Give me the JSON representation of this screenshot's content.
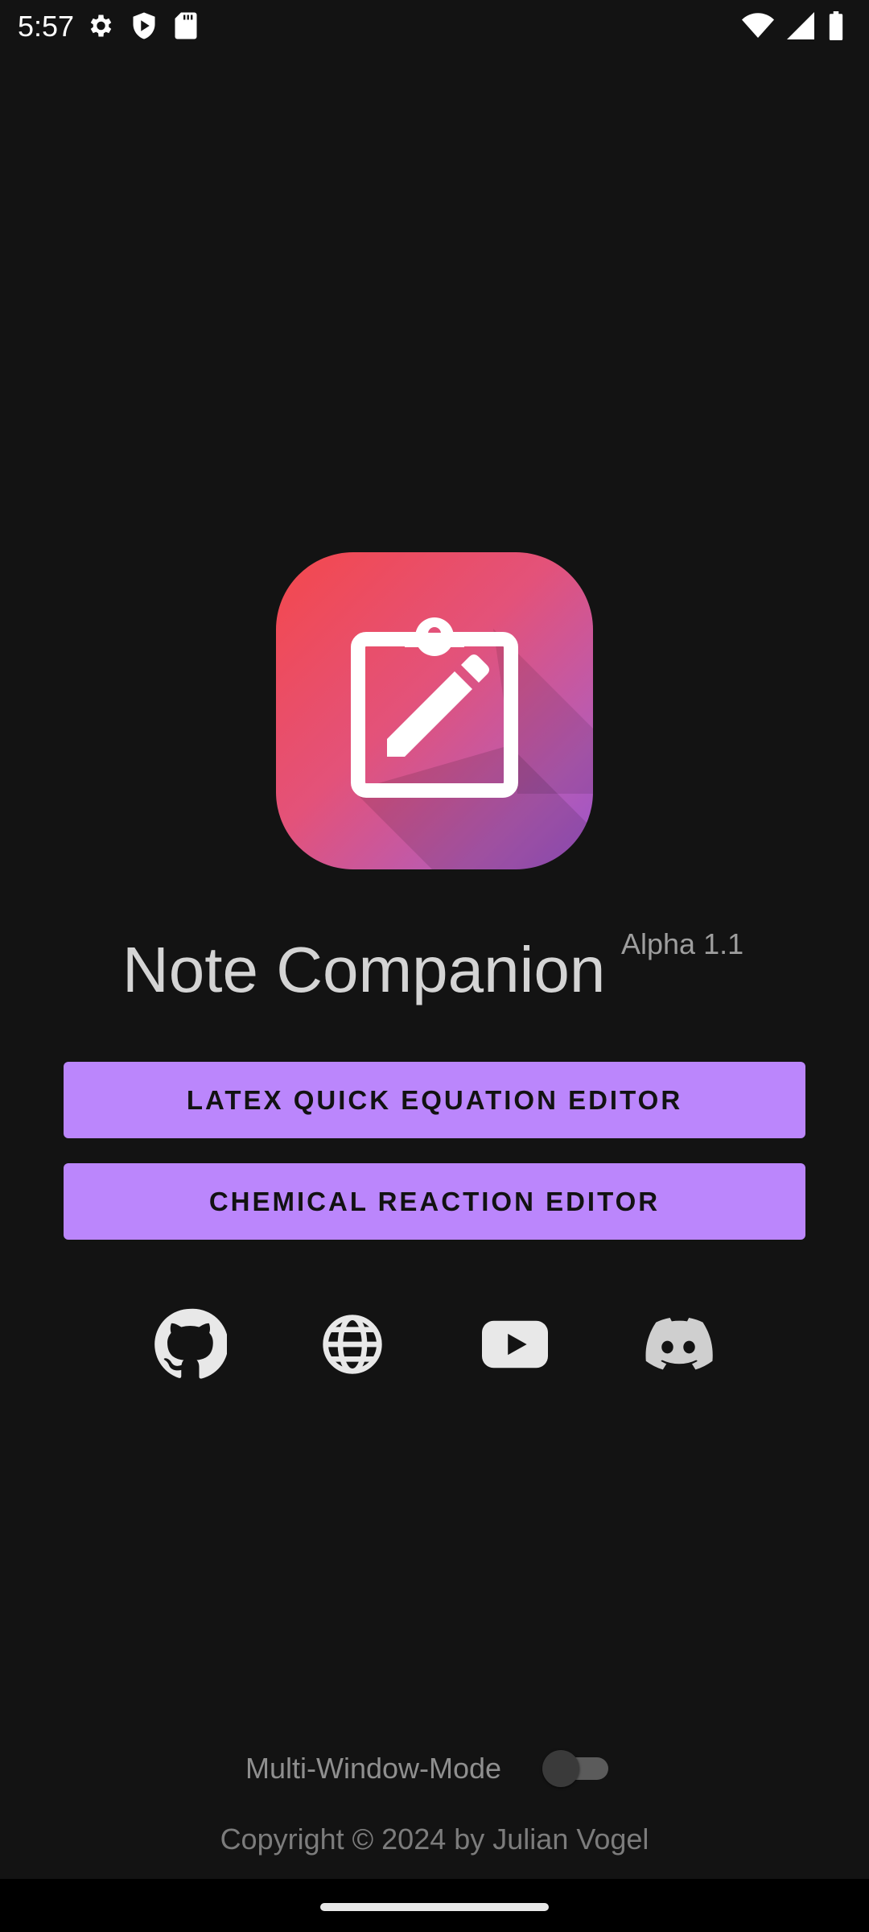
{
  "status_bar": {
    "time": "5:57",
    "icons": [
      "settings-icon",
      "shield-play-icon",
      "sd-card-icon",
      "wifi-icon",
      "signal-icon",
      "battery-icon"
    ]
  },
  "app": {
    "title": "Note Companion",
    "version": "Alpha 1.1",
    "icon": "clipboard-edit-icon",
    "icon_gradient": [
      "#f4484c",
      "#9a52c9"
    ]
  },
  "buttons": {
    "latex": "LATEX QUICK EQUATION EDITOR",
    "chemical": "CHEMICAL REACTION EDITOR"
  },
  "social_links": [
    "github-icon",
    "globe-icon",
    "youtube-icon",
    "discord-icon"
  ],
  "multi_window": {
    "label": "Multi-Window-Mode",
    "enabled": false
  },
  "footer": {
    "copyright": "Copyright © 2024 by Julian Vogel"
  },
  "colors": {
    "background": "#131313",
    "accent": "#bb86fc",
    "title_text": "#d4d4d4"
  }
}
